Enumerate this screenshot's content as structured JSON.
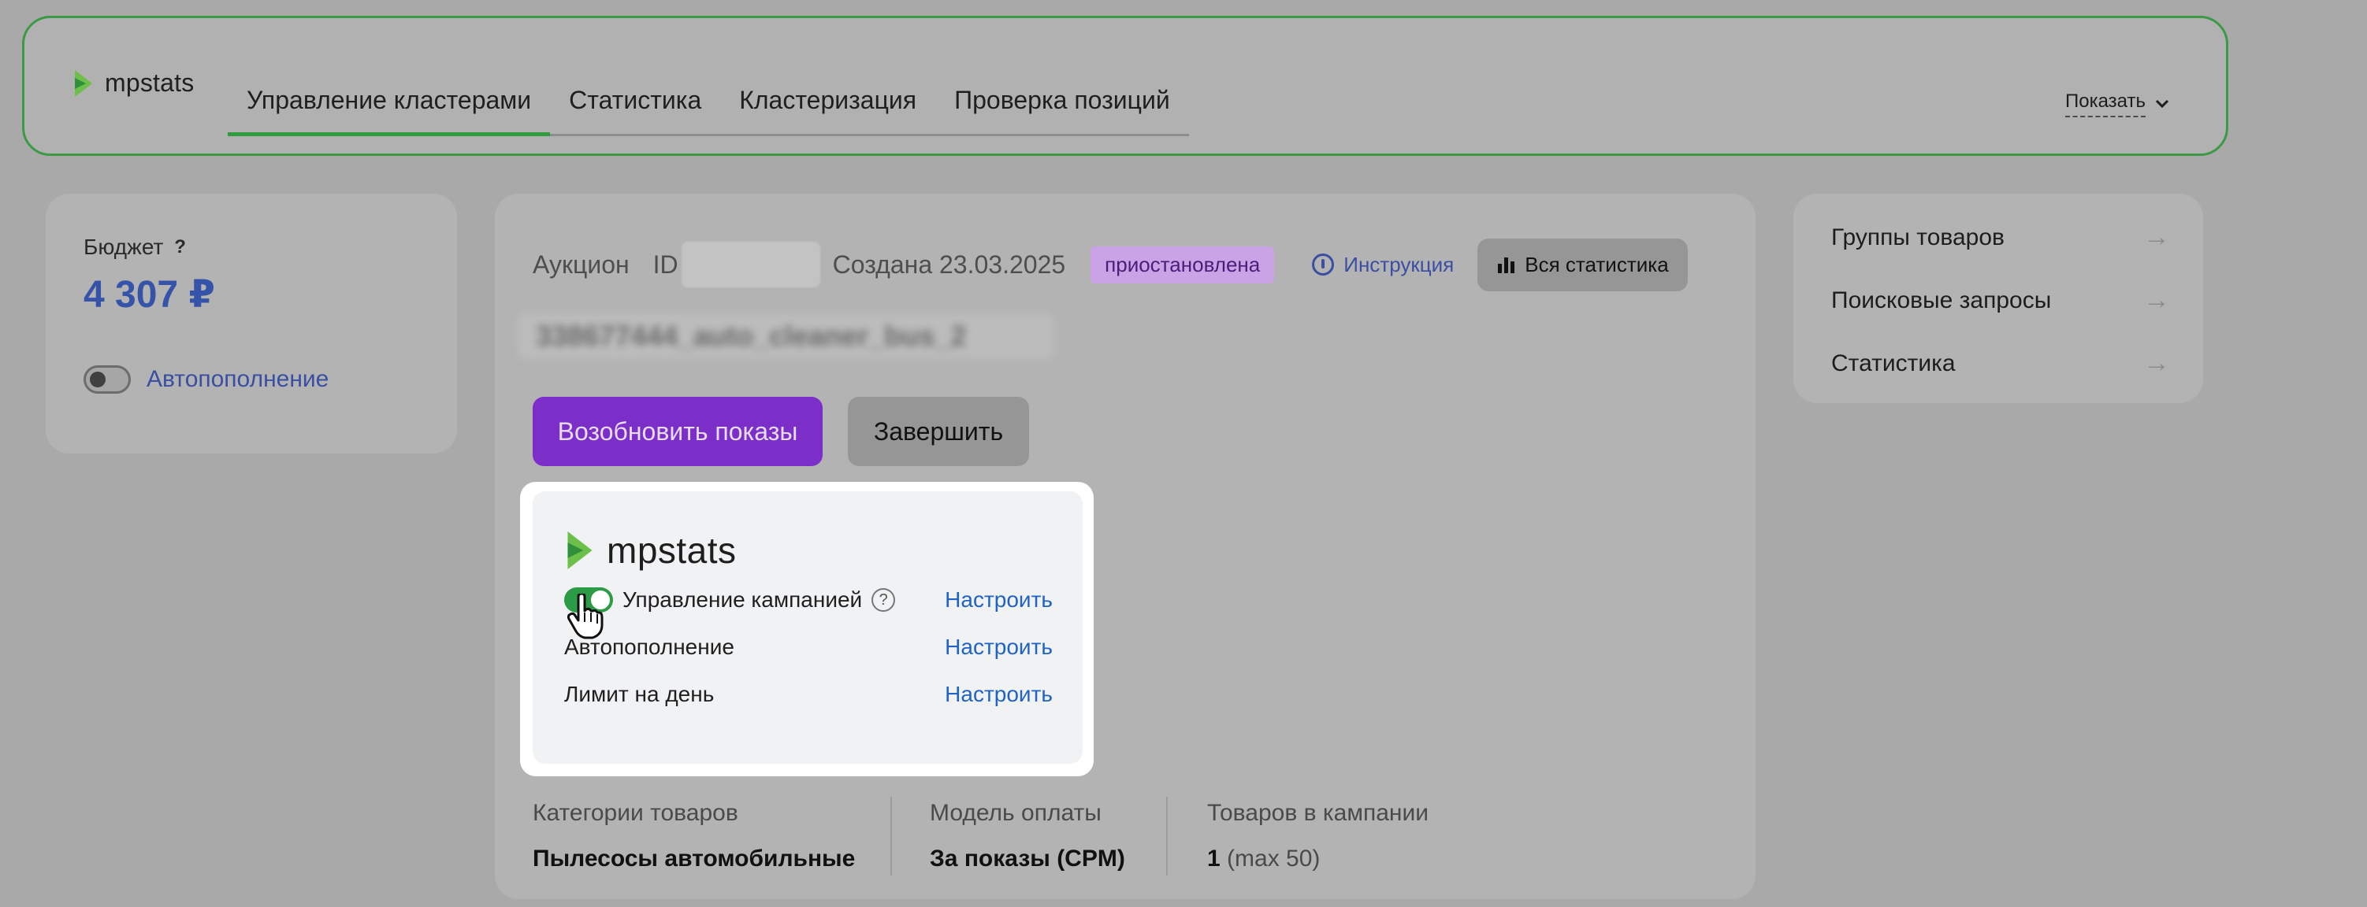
{
  "nav": {
    "logo_text": "mpstats",
    "tabs": [
      {
        "label": "Управление кластерами",
        "active": true
      },
      {
        "label": "Статистика",
        "active": false
      },
      {
        "label": "Кластеризация",
        "active": false
      },
      {
        "label": "Проверка позиций",
        "active": false
      }
    ],
    "show_label": "Показать"
  },
  "budget": {
    "title": "Бюджет",
    "help_mark": "?",
    "value": "4 307 ₽",
    "autofill_label": "Автопополнение",
    "autofill_on": false
  },
  "campaign": {
    "type_label": "Аукцион",
    "id_label": "ID",
    "created_label": "Создана 23.03.2025",
    "status": "приостановлена",
    "instruction_label": "Инструкция",
    "all_stats_label": "Вся статистика",
    "name": "338677444_auto_cleaner_bus_2",
    "resume_label": "Возобновить показы",
    "finish_label": "Завершить",
    "stats": [
      {
        "label": "Категории товаров",
        "value": "Пылесосы автомобильные",
        "extra": ""
      },
      {
        "label": "Модель оплаты",
        "value": "За показы (CPM)",
        "extra": ""
      },
      {
        "label": "Товаров в кампании",
        "value": "1",
        "extra": "(max 50)"
      }
    ]
  },
  "popup": {
    "logo_text": "mpstats",
    "rows": [
      {
        "label": "Управление кампанией",
        "action": "Настроить",
        "toggle": true,
        "help": true
      },
      {
        "label": "Автопополнение",
        "action": "Настроить",
        "toggle": false,
        "help": false
      },
      {
        "label": "Лимит на день",
        "action": "Настроить",
        "toggle": false,
        "help": false
      }
    ],
    "help_mark": "?"
  },
  "right_panel": {
    "items": [
      {
        "label": "Группы товаров"
      },
      {
        "label": "Поисковые запросы"
      },
      {
        "label": "Статистика"
      }
    ],
    "arrow": "→"
  },
  "colors": {
    "accent_green": "#2f9a3e",
    "accent_purple": "#7b2ec8",
    "link_blue": "#1f63c4",
    "budget_blue": "#3553a8"
  }
}
